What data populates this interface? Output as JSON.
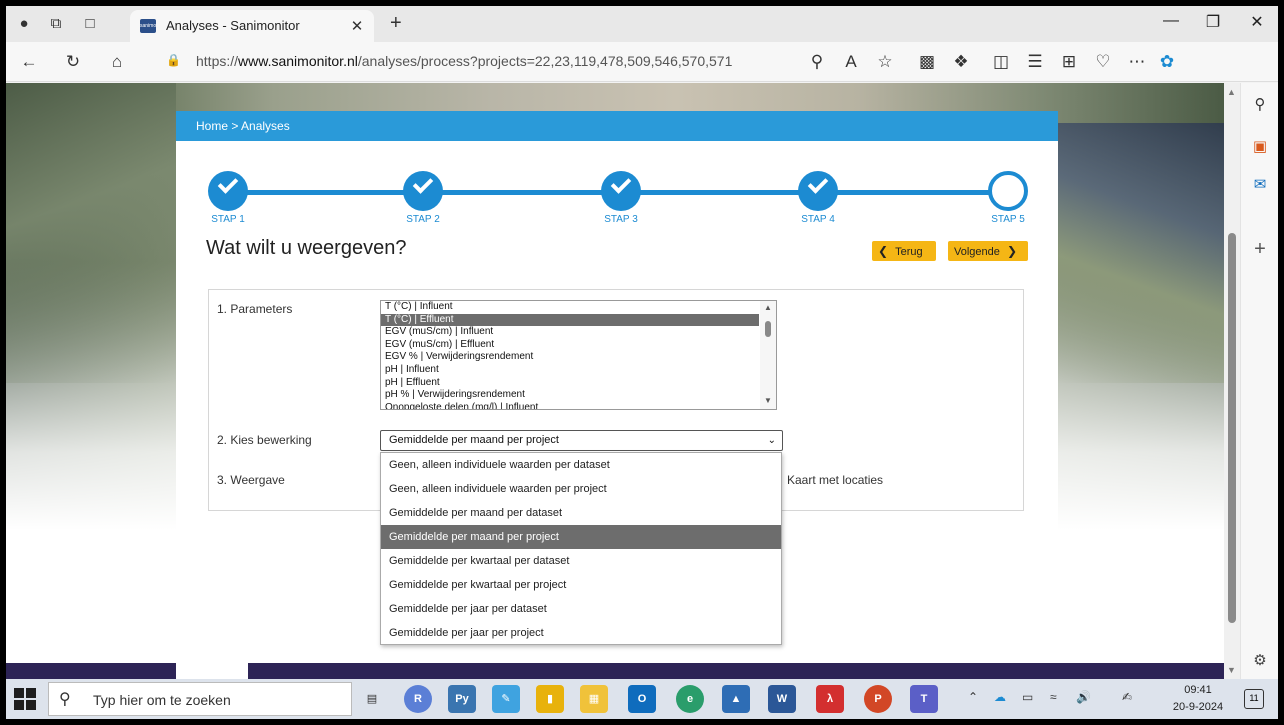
{
  "browser": {
    "tab_title": "Analyses - Sanimonitor",
    "tab_favicon_text": "sanimon",
    "url_prefix": "https://",
    "url_host": "www.sanimonitor.nl",
    "url_path": "/analyses/process?projects=22,23,119,478,509,546,570,571"
  },
  "breadcrumb": "Home  >  Analyses",
  "steps": [
    {
      "label": "STAP 1",
      "state": "done"
    },
    {
      "label": "STAP 2",
      "state": "done"
    },
    {
      "label": "STAP 3",
      "state": "done"
    },
    {
      "label": "STAP 4",
      "state": "done"
    },
    {
      "label": "STAP 5",
      "state": "current"
    }
  ],
  "page_title": "Wat wilt u weergeven?",
  "buttons": {
    "back_label": "Terug",
    "next_label": "Volgende"
  },
  "form": {
    "parameters_label": "1. Parameters",
    "bewerking_label": "2. Kies bewerking",
    "weergave_label": "3. Weergave",
    "map_option_label": "Kaart met locaties",
    "parameters": [
      "T (°C) | Influent",
      "T (°C) | Effluent",
      "EGV (muS/cm) | Influent",
      "EGV (muS/cm) | Effluent",
      "EGV % | Verwijderingsrendement",
      "pH | Influent",
      "pH | Effluent",
      "pH % | Verwijderingsrendement",
      "Onopgeloste delen (mg/l) | Influent"
    ],
    "selected_parameter_index": 1,
    "bewerking_selected": "Gemiddelde per maand per project",
    "bewerking_options": [
      "Geen, alleen individuele waarden per dataset",
      "Geen, alleen individuele waarden per project",
      "Gemiddelde per maand per dataset",
      "Gemiddelde per maand per project",
      "Gemiddelde per kwartaal per dataset",
      "Gemiddelde per kwartaal per project",
      "Gemiddelde per jaar per dataset",
      "Gemiddelde per jaar per project"
    ],
    "active_option_index": 3
  },
  "taskbar": {
    "search_placeholder": "Typ hier om te zoeken",
    "time": "09:41",
    "date": "20-9-2024",
    "notification_count": "11"
  },
  "colors": {
    "accent_blue": "#1c8bd2",
    "breadcrumb_bar": "#2a9ad9",
    "button_yellow": "#f5b615",
    "footer_band": "#2d2456",
    "selection_gray": "#6d6d6d"
  }
}
